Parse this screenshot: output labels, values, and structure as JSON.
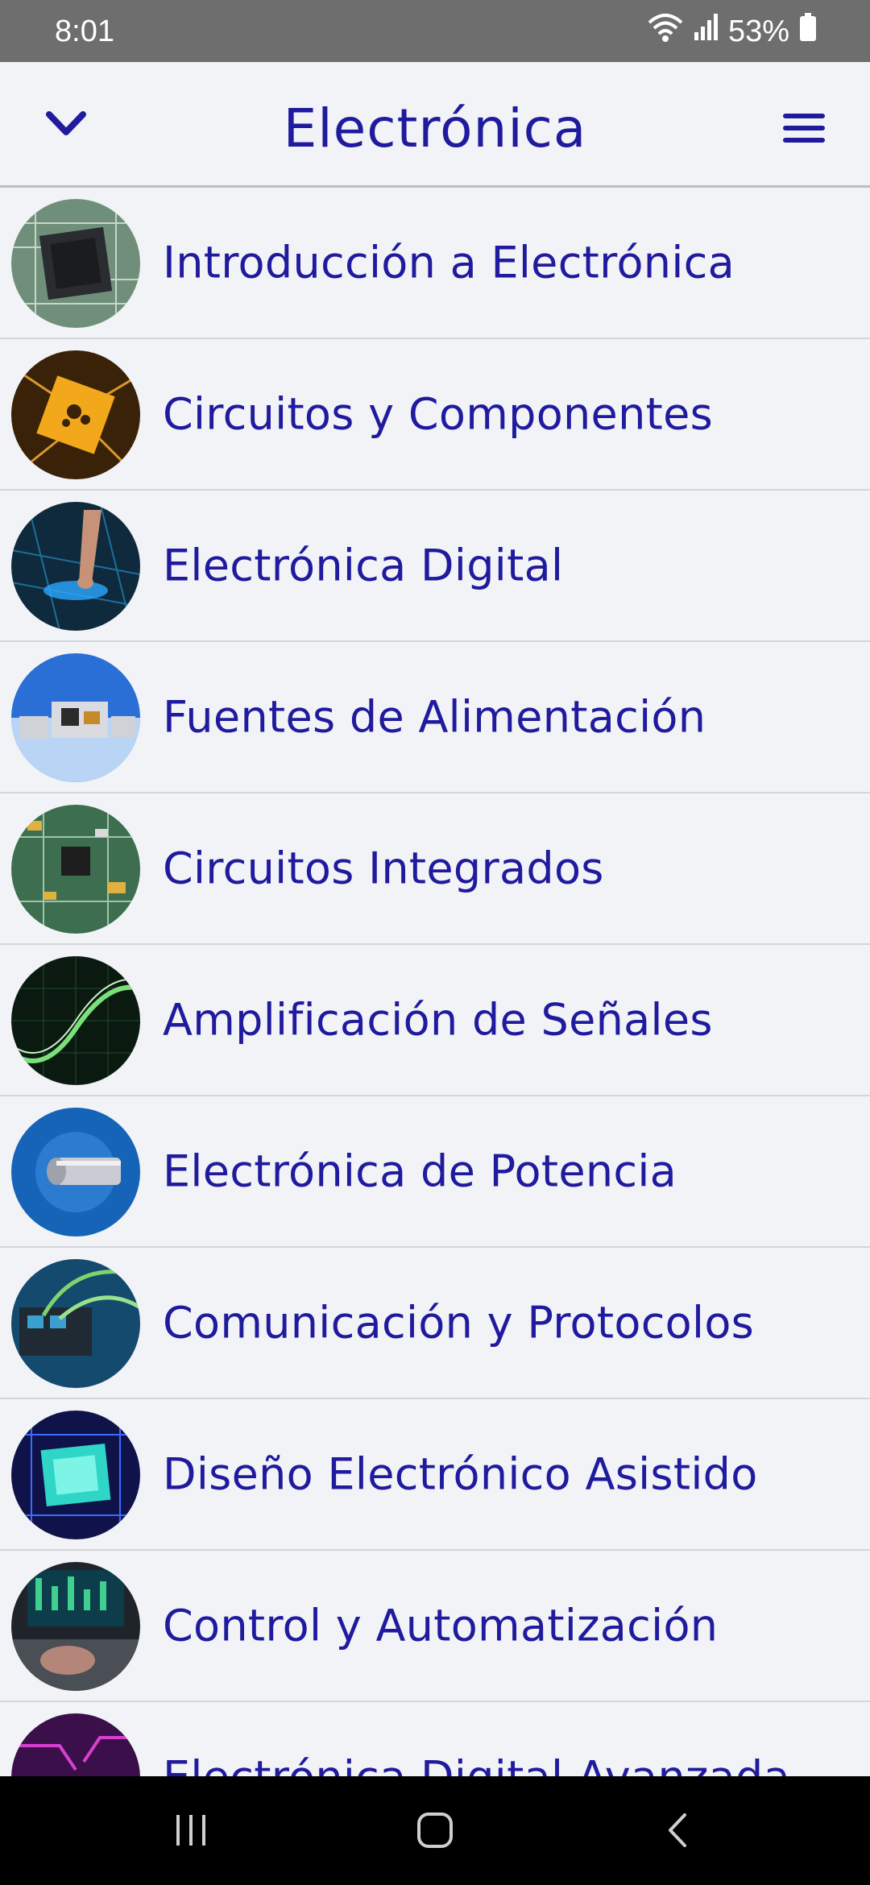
{
  "status_bar": {
    "time": "8:01",
    "battery": "53%",
    "icons": [
      "wifi-icon",
      "signal-icon",
      "battery-icon"
    ]
  },
  "header": {
    "title": "Electrónica",
    "back_icon": "chevron-down-icon",
    "menu_icon": "hamburger-menu-icon"
  },
  "colors": {
    "accent": "#1f1a9e",
    "background": "#f1f3f6",
    "status_bar": "#6e6e6e",
    "nav_bar": "#000000"
  },
  "topics": [
    {
      "label": "Introducción a Electrónica",
      "thumb": "microchip-image"
    },
    {
      "label": "Circuitos y Componentes",
      "thumb": "golden-circuit-image"
    },
    {
      "label": "Electrónica Digital",
      "thumb": "touch-circuit-image"
    },
    {
      "label": "Fuentes de Alimentación",
      "thumb": "power-supply-image"
    },
    {
      "label": "Circuitos Integrados",
      "thumb": "pcb-board-image"
    },
    {
      "label": "Amplificación de Señales",
      "thumb": "signal-wave-image"
    },
    {
      "label": "Electrónica de Potencia",
      "thumb": "power-cylinder-image"
    },
    {
      "label": "Comunicación y Protocolos",
      "thumb": "network-cables-image"
    },
    {
      "label": "Diseño Electrónico Asistido",
      "thumb": "glowing-chip-image"
    },
    {
      "label": "Control y Automatización",
      "thumb": "control-panel-image"
    },
    {
      "label": "Electrónica Digital Avanzada",
      "thumb": "purple-circuit-image"
    }
  ],
  "nav_bar": {
    "buttons": [
      "recent-apps-icon",
      "home-icon",
      "back-icon"
    ]
  }
}
